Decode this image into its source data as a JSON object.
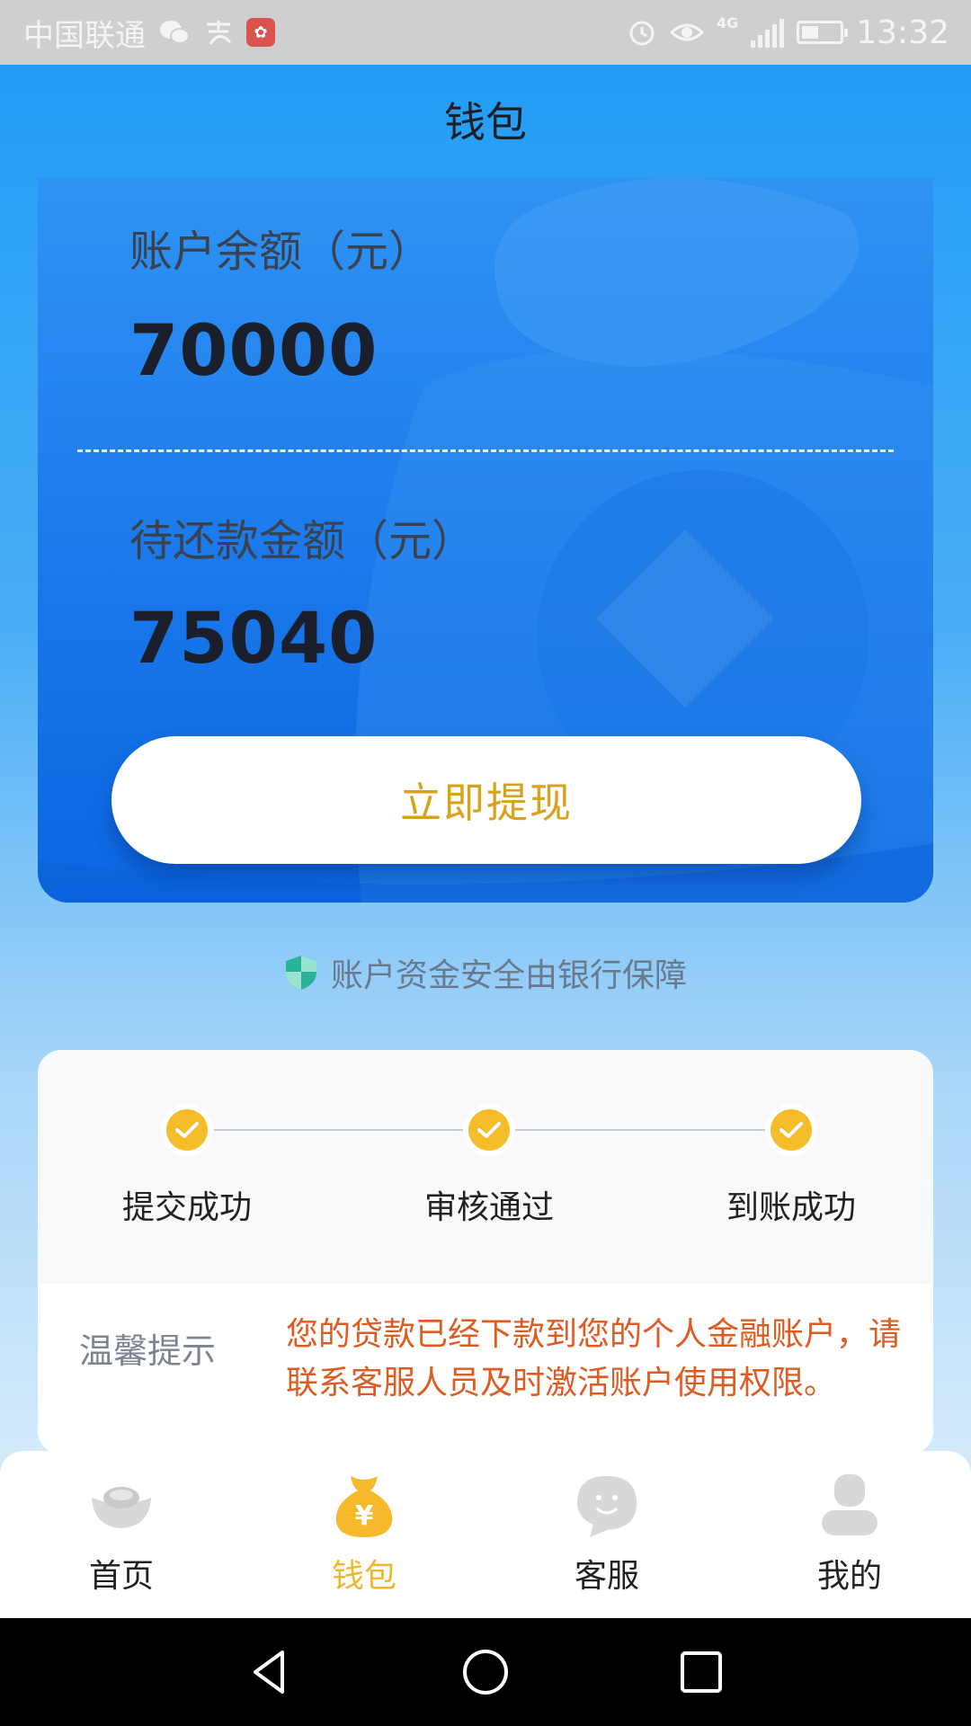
{
  "status_bar": {
    "carrier": "中国联通",
    "network": "4G",
    "time": "13:32"
  },
  "header": {
    "title": "钱包"
  },
  "wallet": {
    "balance_label": "账户余额（元）",
    "balance_value": "70000",
    "repay_label": "待还款金额（元）",
    "repay_value": "75040",
    "withdraw_button": "立即提现"
  },
  "security_note": "账户资金安全由银行保障",
  "progress": {
    "steps": [
      {
        "label": "提交成功"
      },
      {
        "label": "审核通过"
      },
      {
        "label": "到账成功"
      }
    ],
    "tips_title": "温馨提示",
    "tips_body": "您的贷款已经下款到您的个人金融账户，请联系客服人员及时激活账户使用权限。"
  },
  "tabbar": {
    "items": [
      {
        "label": "首页",
        "icon": "ingot-icon",
        "active": false
      },
      {
        "label": "钱包",
        "icon": "money-bag-icon",
        "active": true
      },
      {
        "label": "客服",
        "icon": "chat-icon",
        "active": false
      },
      {
        "label": "我的",
        "icon": "user-icon",
        "active": false
      }
    ]
  },
  "colors": {
    "accent": "#f0b72b",
    "primary": "#1e88f0",
    "tip_text": "#de5b22"
  }
}
